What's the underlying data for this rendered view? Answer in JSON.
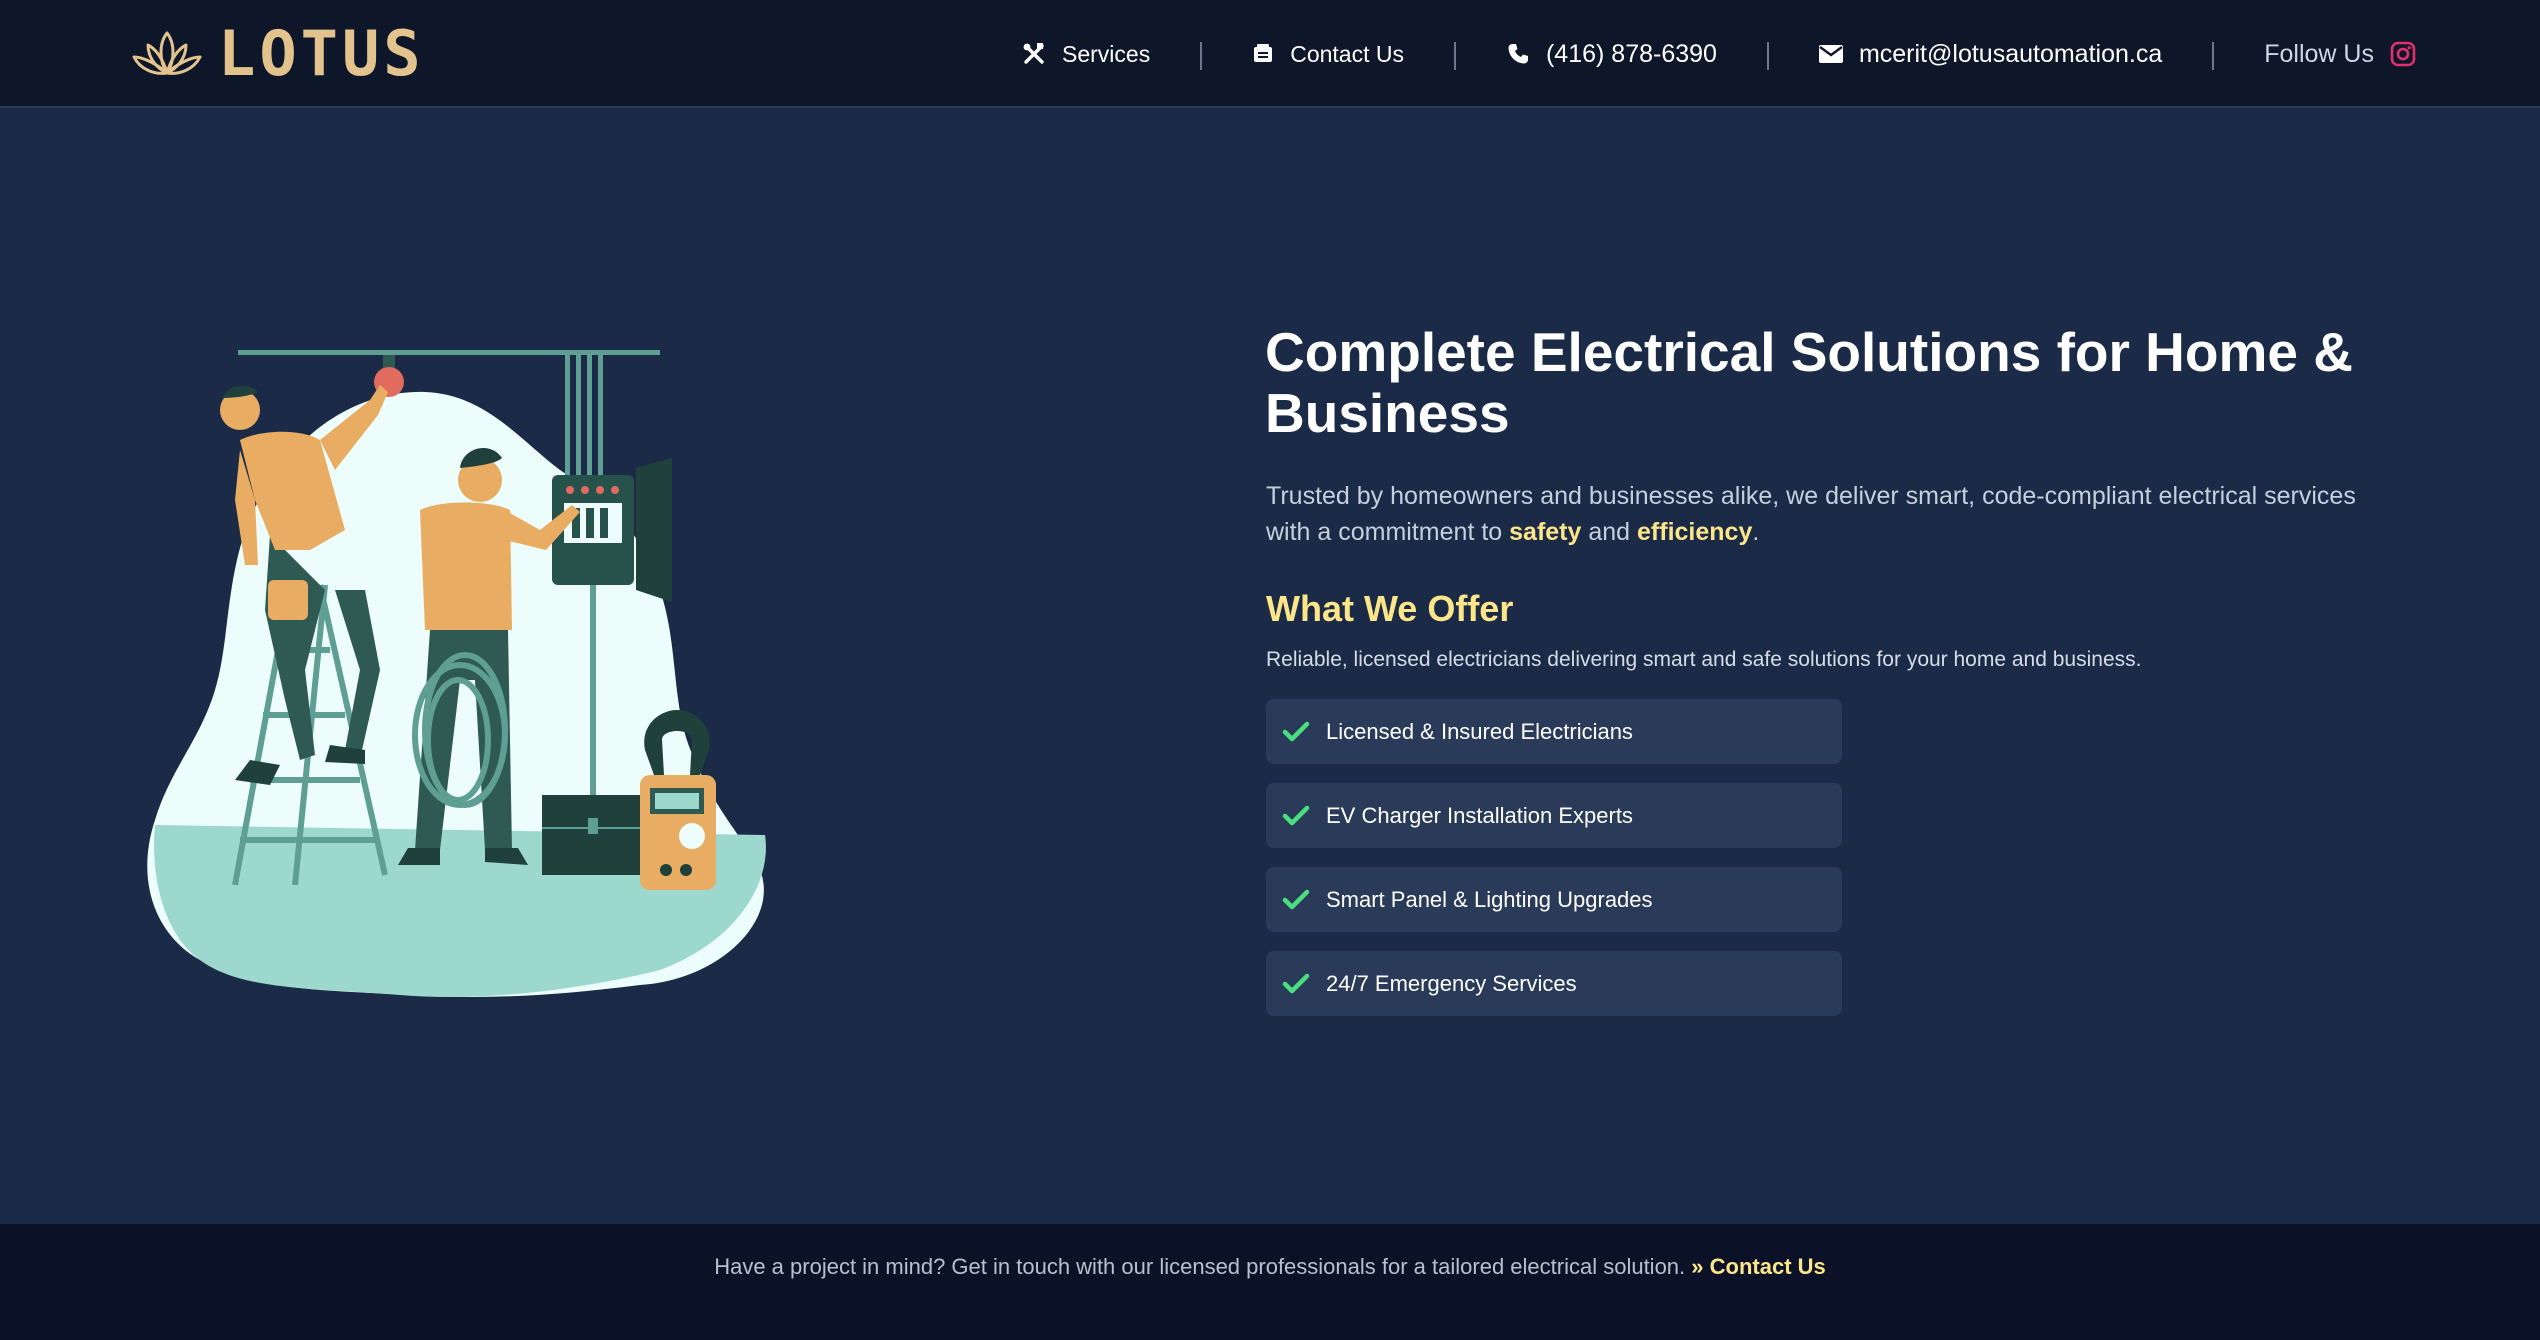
{
  "brand": {
    "name": "LOTUS",
    "accent_color": "#e2c38d"
  },
  "nav": {
    "services": "Services",
    "contact": "Contact Us",
    "phone": "(416) 878-6390",
    "email": "mcerit@lotusautomation.ca",
    "follow": "Follow Us",
    "separator": "|"
  },
  "icons": {
    "services": "tools-icon",
    "contact": "contact-card-icon",
    "phone": "phone-icon",
    "email": "envelope-icon",
    "social": "instagram-icon",
    "check": "check-icon"
  },
  "hero": {
    "title": "Complete Electrical Solutions for Home & Business",
    "desc_prefix": "Trusted by homeowners and businesses alike, we deliver smart, code-compliant electrical services with a commitment to ",
    "desc_hl1": "safety",
    "desc_mid": " and ",
    "desc_hl2": "efficiency",
    "desc_end": "."
  },
  "offer": {
    "title": "What We Offer",
    "subtitle": "Reliable, licensed electricians delivering smart and safe solutions for your home and business.",
    "items": [
      "Licensed & Insured Electricians",
      "EV Charger Installation Experts",
      "Smart Panel & Lighting Upgrades",
      "24/7 Emergency Services"
    ]
  },
  "footer": {
    "text": "Have a project in mind? Get in touch with our licensed professionals for a tailored electrical solution.",
    "link_prefix": "»",
    "link": "Contact Us"
  },
  "colors": {
    "background": "#1b2b47",
    "header": "#0e1629",
    "footer": "#0b1227",
    "highlight": "#fde68a",
    "check": "#4ade80",
    "instagram": "#e1306c"
  }
}
